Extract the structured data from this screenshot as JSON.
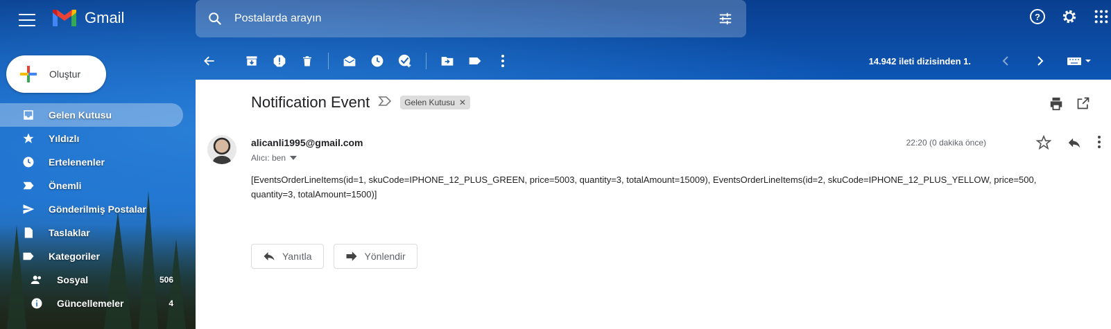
{
  "app": {
    "name": "Gmail"
  },
  "search": {
    "placeholder": "Postalarda arayın"
  },
  "compose": {
    "label": "Oluştur"
  },
  "sidebar": {
    "items": [
      {
        "label": "Gelen Kutusu",
        "icon": "inbox-icon",
        "active": true
      },
      {
        "label": "Yıldızlı",
        "icon": "star-icon"
      },
      {
        "label": "Ertelenenler",
        "icon": "clock-icon"
      },
      {
        "label": "Önemli",
        "icon": "important-label-icon"
      },
      {
        "label": "Gönderilmiş Postalar",
        "icon": "send-icon"
      },
      {
        "label": "Taslaklar",
        "icon": "draft-icon"
      },
      {
        "label": "Kategoriler",
        "icon": "label-icon"
      },
      {
        "label": "Sosyal",
        "icon": "people-icon",
        "count": "506"
      },
      {
        "label": "Güncellemeler",
        "icon": "info-icon",
        "count": "4"
      }
    ]
  },
  "toolbar": {
    "pager_text": "14.942 ileti dizisinden 1."
  },
  "email": {
    "subject": "Notification Event",
    "label_chip": "Gelen Kutusu",
    "sender": "alicanli1995@gmail.com",
    "recipient": "Alıcı: ben",
    "time": "22:20 (0 dakika önce)",
    "body": "[EventsOrderLineItems(id=1, skuCode=IPHONE_12_PLUS_GREEN, price=5003, quantity=3, totalAmount=15009), EventsOrderLineItems(id=2, skuCode=IPHONE_12_PLUS_YELLOW, price=500, quantity=3, totalAmount=1500)]"
  },
  "actions": {
    "reply": "Yanıtla",
    "forward": "Yönlendir"
  },
  "colors": {
    "accent_blue": "#1a6fcf",
    "panel_bg": "#ffffff"
  }
}
